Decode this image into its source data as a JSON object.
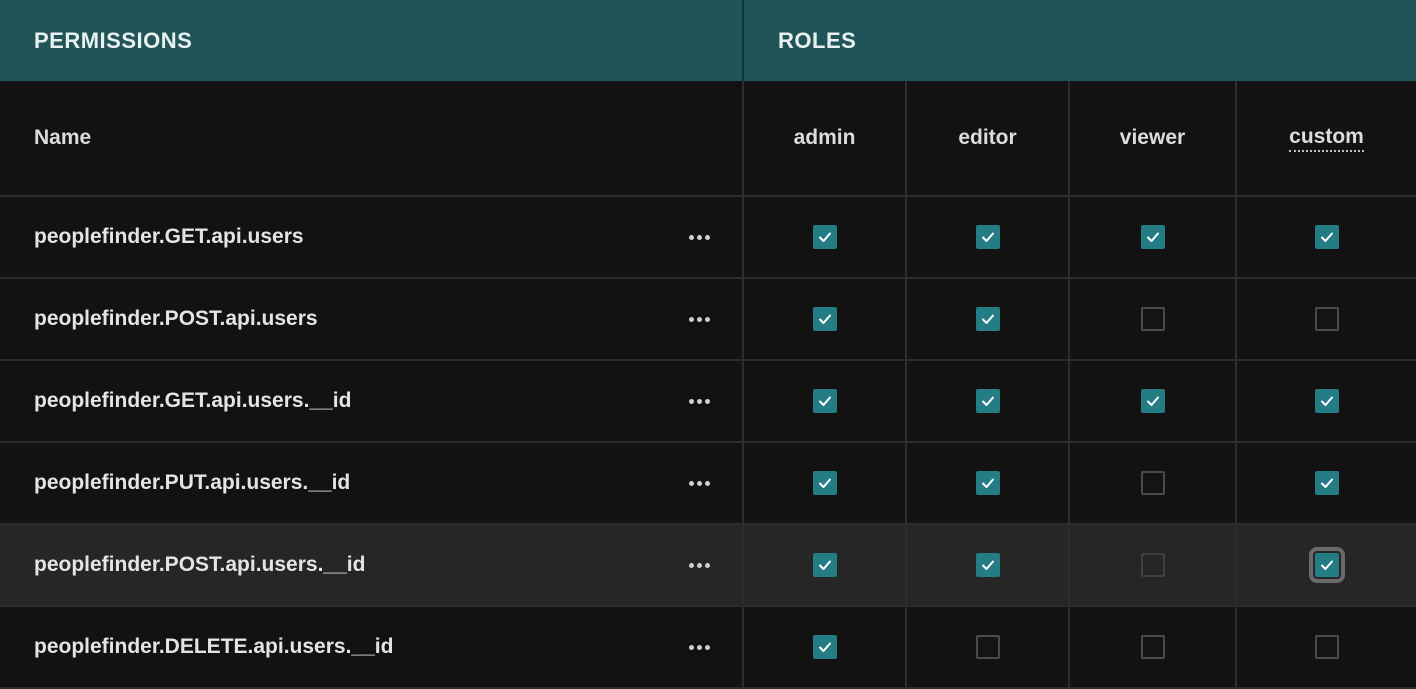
{
  "header": {
    "permissions_label": "PERMISSIONS",
    "roles_label": "ROLES"
  },
  "columns": {
    "name_label": "Name",
    "roles": [
      "admin",
      "editor",
      "viewer",
      "custom"
    ]
  },
  "rows": [
    {
      "name": "peoplefinder.GET.api.users",
      "checks": [
        true,
        true,
        true,
        true
      ]
    },
    {
      "name": "peoplefinder.POST.api.users",
      "checks": [
        true,
        true,
        false,
        false
      ]
    },
    {
      "name": "peoplefinder.GET.api.users.__id",
      "checks": [
        true,
        true,
        true,
        true
      ]
    },
    {
      "name": "peoplefinder.PUT.api.users.__id",
      "checks": [
        true,
        true,
        false,
        true
      ]
    },
    {
      "name": "peoplefinder.POST.api.users.__id",
      "checks": [
        true,
        true,
        false,
        true
      ],
      "highlighted": true,
      "focused_col": 3
    },
    {
      "name": "peoplefinder.DELETE.api.users.__id",
      "checks": [
        true,
        false,
        false,
        false
      ]
    }
  ],
  "icons": {
    "more": "more-horizontal-icon",
    "check": "checkmark-icon"
  },
  "colors": {
    "header_bg": "#215458",
    "checkbox_on": "#247c84",
    "background": "#121212"
  }
}
